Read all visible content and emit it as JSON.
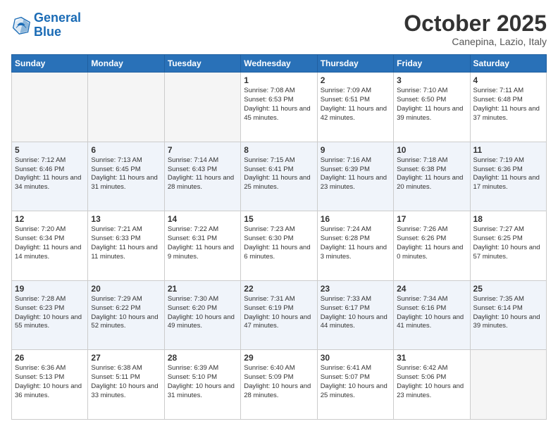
{
  "header": {
    "logo_general": "General",
    "logo_blue": "Blue",
    "title": "October 2025",
    "subtitle": "Canepina, Lazio, Italy"
  },
  "days_of_week": [
    "Sunday",
    "Monday",
    "Tuesday",
    "Wednesday",
    "Thursday",
    "Friday",
    "Saturday"
  ],
  "weeks": [
    [
      {
        "day": "",
        "info": ""
      },
      {
        "day": "",
        "info": ""
      },
      {
        "day": "",
        "info": ""
      },
      {
        "day": "1",
        "info": "Sunrise: 7:08 AM\nSunset: 6:53 PM\nDaylight: 11 hours and 45 minutes."
      },
      {
        "day": "2",
        "info": "Sunrise: 7:09 AM\nSunset: 6:51 PM\nDaylight: 11 hours and 42 minutes."
      },
      {
        "day": "3",
        "info": "Sunrise: 7:10 AM\nSunset: 6:50 PM\nDaylight: 11 hours and 39 minutes."
      },
      {
        "day": "4",
        "info": "Sunrise: 7:11 AM\nSunset: 6:48 PM\nDaylight: 11 hours and 37 minutes."
      }
    ],
    [
      {
        "day": "5",
        "info": "Sunrise: 7:12 AM\nSunset: 6:46 PM\nDaylight: 11 hours and 34 minutes."
      },
      {
        "day": "6",
        "info": "Sunrise: 7:13 AM\nSunset: 6:45 PM\nDaylight: 11 hours and 31 minutes."
      },
      {
        "day": "7",
        "info": "Sunrise: 7:14 AM\nSunset: 6:43 PM\nDaylight: 11 hours and 28 minutes."
      },
      {
        "day": "8",
        "info": "Sunrise: 7:15 AM\nSunset: 6:41 PM\nDaylight: 11 hours and 25 minutes."
      },
      {
        "day": "9",
        "info": "Sunrise: 7:16 AM\nSunset: 6:39 PM\nDaylight: 11 hours and 23 minutes."
      },
      {
        "day": "10",
        "info": "Sunrise: 7:18 AM\nSunset: 6:38 PM\nDaylight: 11 hours and 20 minutes."
      },
      {
        "day": "11",
        "info": "Sunrise: 7:19 AM\nSunset: 6:36 PM\nDaylight: 11 hours and 17 minutes."
      }
    ],
    [
      {
        "day": "12",
        "info": "Sunrise: 7:20 AM\nSunset: 6:34 PM\nDaylight: 11 hours and 14 minutes."
      },
      {
        "day": "13",
        "info": "Sunrise: 7:21 AM\nSunset: 6:33 PM\nDaylight: 11 hours and 11 minutes."
      },
      {
        "day": "14",
        "info": "Sunrise: 7:22 AM\nSunset: 6:31 PM\nDaylight: 11 hours and 9 minutes."
      },
      {
        "day": "15",
        "info": "Sunrise: 7:23 AM\nSunset: 6:30 PM\nDaylight: 11 hours and 6 minutes."
      },
      {
        "day": "16",
        "info": "Sunrise: 7:24 AM\nSunset: 6:28 PM\nDaylight: 11 hours and 3 minutes."
      },
      {
        "day": "17",
        "info": "Sunrise: 7:26 AM\nSunset: 6:26 PM\nDaylight: 11 hours and 0 minutes."
      },
      {
        "day": "18",
        "info": "Sunrise: 7:27 AM\nSunset: 6:25 PM\nDaylight: 10 hours and 57 minutes."
      }
    ],
    [
      {
        "day": "19",
        "info": "Sunrise: 7:28 AM\nSunset: 6:23 PM\nDaylight: 10 hours and 55 minutes."
      },
      {
        "day": "20",
        "info": "Sunrise: 7:29 AM\nSunset: 6:22 PM\nDaylight: 10 hours and 52 minutes."
      },
      {
        "day": "21",
        "info": "Sunrise: 7:30 AM\nSunset: 6:20 PM\nDaylight: 10 hours and 49 minutes."
      },
      {
        "day": "22",
        "info": "Sunrise: 7:31 AM\nSunset: 6:19 PM\nDaylight: 10 hours and 47 minutes."
      },
      {
        "day": "23",
        "info": "Sunrise: 7:33 AM\nSunset: 6:17 PM\nDaylight: 10 hours and 44 minutes."
      },
      {
        "day": "24",
        "info": "Sunrise: 7:34 AM\nSunset: 6:16 PM\nDaylight: 10 hours and 41 minutes."
      },
      {
        "day": "25",
        "info": "Sunrise: 7:35 AM\nSunset: 6:14 PM\nDaylight: 10 hours and 39 minutes."
      }
    ],
    [
      {
        "day": "26",
        "info": "Sunrise: 6:36 AM\nSunset: 5:13 PM\nDaylight: 10 hours and 36 minutes."
      },
      {
        "day": "27",
        "info": "Sunrise: 6:38 AM\nSunset: 5:11 PM\nDaylight: 10 hours and 33 minutes."
      },
      {
        "day": "28",
        "info": "Sunrise: 6:39 AM\nSunset: 5:10 PM\nDaylight: 10 hours and 31 minutes."
      },
      {
        "day": "29",
        "info": "Sunrise: 6:40 AM\nSunset: 5:09 PM\nDaylight: 10 hours and 28 minutes."
      },
      {
        "day": "30",
        "info": "Sunrise: 6:41 AM\nSunset: 5:07 PM\nDaylight: 10 hours and 25 minutes."
      },
      {
        "day": "31",
        "info": "Sunrise: 6:42 AM\nSunset: 5:06 PM\nDaylight: 10 hours and 23 minutes."
      },
      {
        "day": "",
        "info": ""
      }
    ]
  ]
}
